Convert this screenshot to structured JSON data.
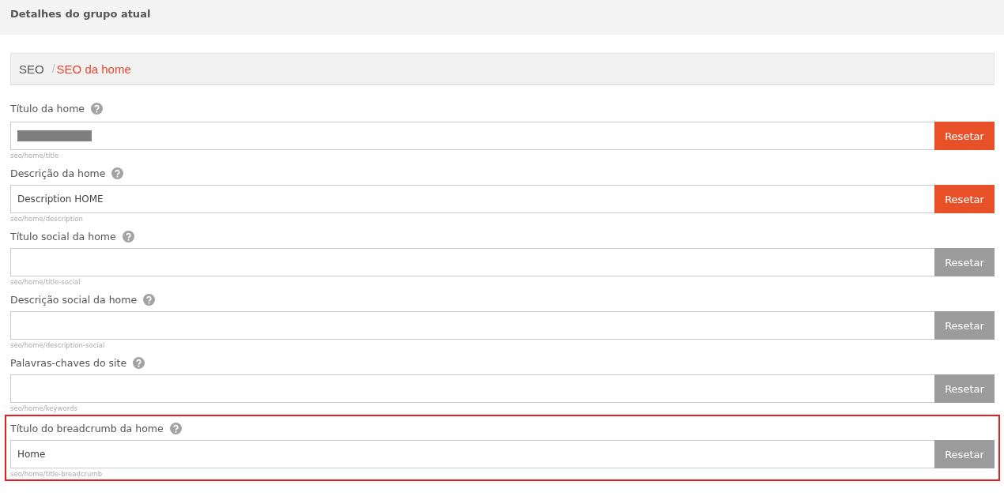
{
  "header": {
    "title": "Detalhes do grupo atual"
  },
  "breadcrumb_separator": "/",
  "breadcrumb": [
    {
      "label": "SEO",
      "selected": false
    },
    {
      "label": "SEO da home",
      "selected": true
    }
  ],
  "fields": [
    {
      "label": "Título da home",
      "redacted": true,
      "path": "seo/home/title",
      "button": "Resetar",
      "button_active": true,
      "highlighted": false
    },
    {
      "label": "Descrição da home",
      "value": "Description HOME",
      "redacted": false,
      "path": "seo/home/description",
      "button": "Resetar",
      "button_active": true,
      "highlighted": false
    },
    {
      "label": "Título social da home",
      "redacted": false,
      "path": "seo/home/title-social",
      "button": "Resetar",
      "button_active": false,
      "highlighted": false
    },
    {
      "label": "Descrição social da home",
      "redacted": false,
      "path": "seo/home/description-social",
      "button": "Resetar",
      "button_active": false,
      "highlighted": false
    },
    {
      "label": "Palavras-chaves do site",
      "redacted": false,
      "path": "seo/home/keywords",
      "button": "Resetar",
      "button_active": false,
      "highlighted": false
    },
    {
      "label": "Título do breadcrumb da home",
      "value": "Home",
      "redacted": false,
      "path": "seo/home/title-breadcrumb",
      "button": "Resetar",
      "button_active": false,
      "highlighted": true
    }
  ]
}
